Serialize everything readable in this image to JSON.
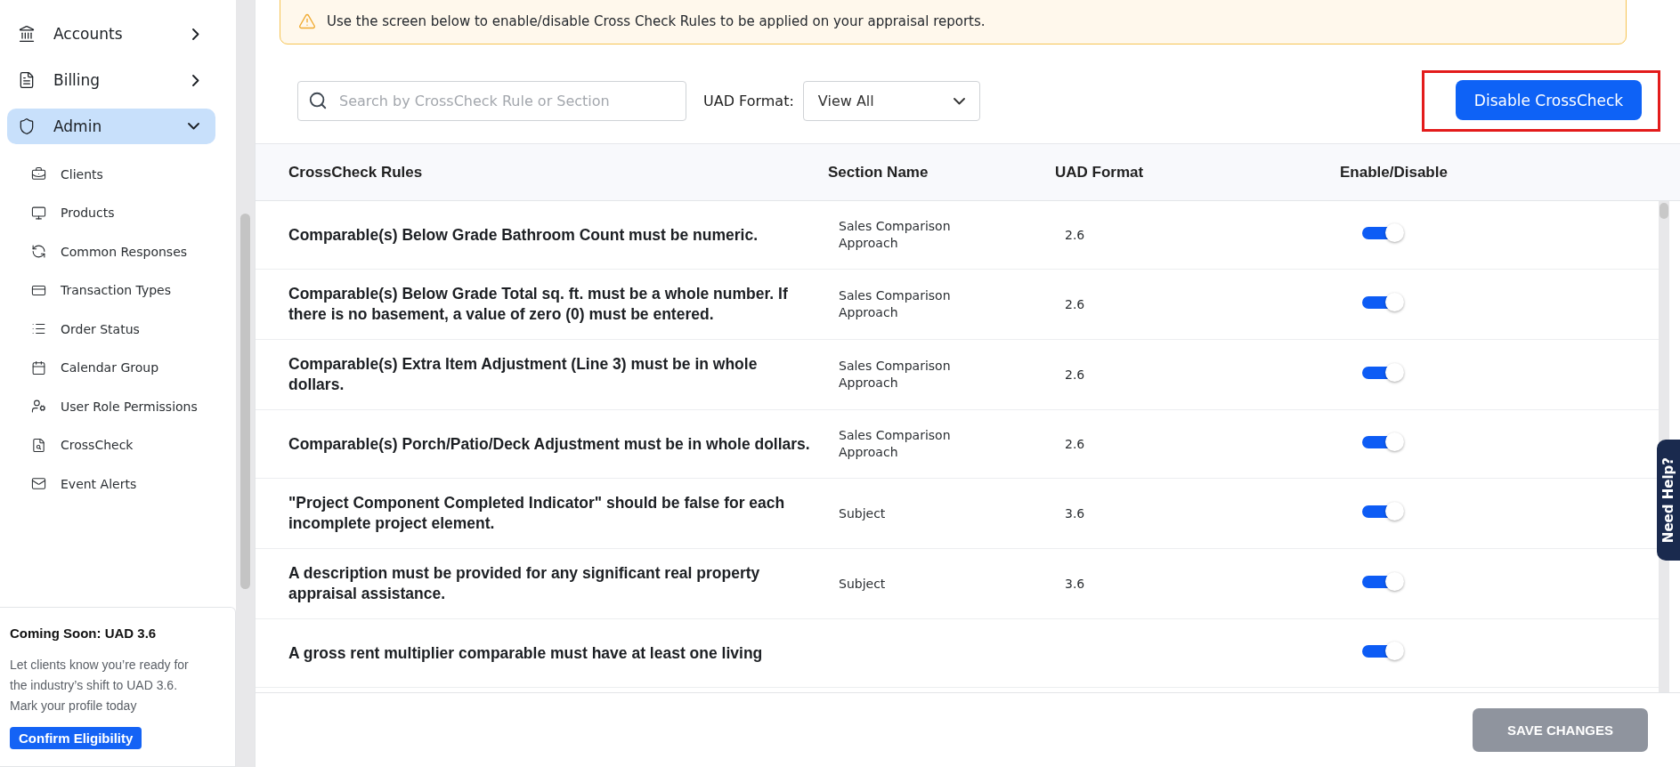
{
  "sidebar": {
    "items": [
      {
        "label": "Accounts",
        "selected": false,
        "expanded": false
      },
      {
        "label": "Billing",
        "selected": false,
        "expanded": false
      },
      {
        "label": "Admin",
        "selected": true,
        "expanded": true,
        "children": [
          {
            "label": "Clients"
          },
          {
            "label": "Products"
          },
          {
            "label": "Common Responses"
          },
          {
            "label": "Transaction Types"
          },
          {
            "label": "Order Status"
          },
          {
            "label": "Calendar Group"
          },
          {
            "label": "User Role Permissions"
          },
          {
            "label": "CrossCheck"
          },
          {
            "label": "Event Alerts"
          }
        ]
      }
    ],
    "promo": {
      "title": "Coming Soon: UAD 3.6",
      "body": "Let clients know you’re ready for the industry’s shift to UAD 3.6. Mark your profile today",
      "button": "Confirm Eligibility"
    }
  },
  "notice": "Use the screen below to enable/disable Cross Check Rules to be applied on your appraisal reports.",
  "toolbar": {
    "search": {
      "placeholder": "Search by CrossCheck Rule or Section"
    },
    "filter_label": "UAD Format:",
    "filter_value": "View All",
    "action_button": "Disable CrossCheck"
  },
  "table": {
    "columns": [
      "CrossCheck Rules",
      "Section Name",
      "UAD Format",
      "Enable/Disable"
    ],
    "rows": [
      {
        "rule": "Comparable(s) Below Grade Bathroom Count must be numeric.",
        "section": "Sales Comparison Approach",
        "uad_format": "2.6",
        "enabled": true
      },
      {
        "rule": "Comparable(s) Below Grade Total sq. ft. must be a whole number. If there is no basement, a value of zero (0) must be entered.",
        "section": "Sales Comparison Approach",
        "uad_format": "2.6",
        "enabled": true
      },
      {
        "rule": "Comparable(s) Extra Item Adjustment (Line 3) must be in whole dollars.",
        "section": "Sales Comparison Approach",
        "uad_format": "2.6",
        "enabled": true
      },
      {
        "rule": "Comparable(s) Porch/Patio/Deck Adjustment must be in whole dollars.",
        "section": "Sales Comparison Approach",
        "uad_format": "2.6",
        "enabled": true
      },
      {
        "rule": "\"Project Component Completed Indicator\" should be false for each incomplete project element.",
        "section": "Subject",
        "uad_format": "3.6",
        "enabled": true
      },
      {
        "rule": "A description must be provided for any significant real property appraisal assistance.",
        "section": "Subject",
        "uad_format": "3.6",
        "enabled": true
      },
      {
        "rule": "A gross rent multiplier comparable must have at least one living",
        "enabled": true
      }
    ]
  },
  "help_tab": "Need Help?",
  "save_button": "SAVE CHANGES"
}
